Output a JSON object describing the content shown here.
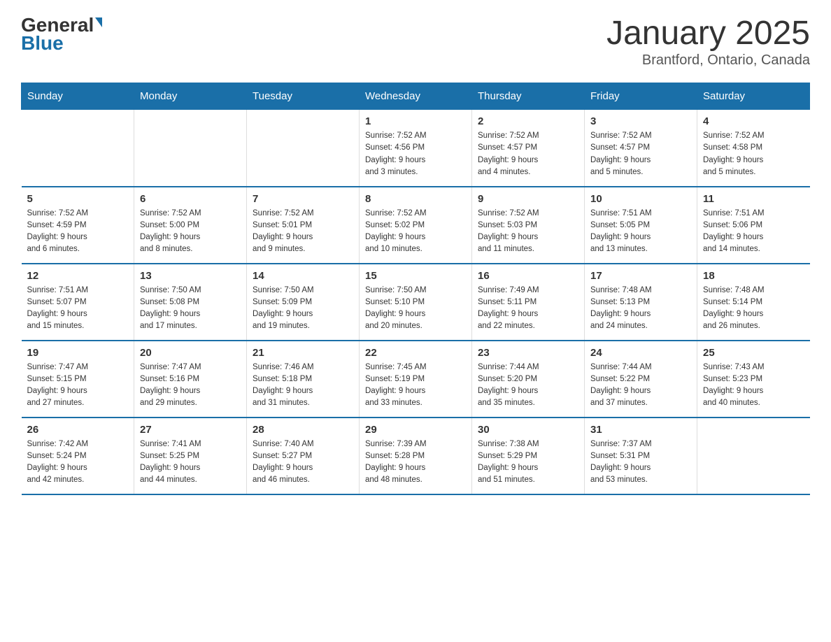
{
  "header": {
    "logo_general": "General",
    "logo_blue": "Blue",
    "month_title": "January 2025",
    "location": "Brantford, Ontario, Canada"
  },
  "days_of_week": [
    "Sunday",
    "Monday",
    "Tuesday",
    "Wednesday",
    "Thursday",
    "Friday",
    "Saturday"
  ],
  "weeks": [
    [
      {
        "day": "",
        "info": ""
      },
      {
        "day": "",
        "info": ""
      },
      {
        "day": "",
        "info": ""
      },
      {
        "day": "1",
        "info": "Sunrise: 7:52 AM\nSunset: 4:56 PM\nDaylight: 9 hours\nand 3 minutes."
      },
      {
        "day": "2",
        "info": "Sunrise: 7:52 AM\nSunset: 4:57 PM\nDaylight: 9 hours\nand 4 minutes."
      },
      {
        "day": "3",
        "info": "Sunrise: 7:52 AM\nSunset: 4:57 PM\nDaylight: 9 hours\nand 5 minutes."
      },
      {
        "day": "4",
        "info": "Sunrise: 7:52 AM\nSunset: 4:58 PM\nDaylight: 9 hours\nand 5 minutes."
      }
    ],
    [
      {
        "day": "5",
        "info": "Sunrise: 7:52 AM\nSunset: 4:59 PM\nDaylight: 9 hours\nand 6 minutes."
      },
      {
        "day": "6",
        "info": "Sunrise: 7:52 AM\nSunset: 5:00 PM\nDaylight: 9 hours\nand 8 minutes."
      },
      {
        "day": "7",
        "info": "Sunrise: 7:52 AM\nSunset: 5:01 PM\nDaylight: 9 hours\nand 9 minutes."
      },
      {
        "day": "8",
        "info": "Sunrise: 7:52 AM\nSunset: 5:02 PM\nDaylight: 9 hours\nand 10 minutes."
      },
      {
        "day": "9",
        "info": "Sunrise: 7:52 AM\nSunset: 5:03 PM\nDaylight: 9 hours\nand 11 minutes."
      },
      {
        "day": "10",
        "info": "Sunrise: 7:51 AM\nSunset: 5:05 PM\nDaylight: 9 hours\nand 13 minutes."
      },
      {
        "day": "11",
        "info": "Sunrise: 7:51 AM\nSunset: 5:06 PM\nDaylight: 9 hours\nand 14 minutes."
      }
    ],
    [
      {
        "day": "12",
        "info": "Sunrise: 7:51 AM\nSunset: 5:07 PM\nDaylight: 9 hours\nand 15 minutes."
      },
      {
        "day": "13",
        "info": "Sunrise: 7:50 AM\nSunset: 5:08 PM\nDaylight: 9 hours\nand 17 minutes."
      },
      {
        "day": "14",
        "info": "Sunrise: 7:50 AM\nSunset: 5:09 PM\nDaylight: 9 hours\nand 19 minutes."
      },
      {
        "day": "15",
        "info": "Sunrise: 7:50 AM\nSunset: 5:10 PM\nDaylight: 9 hours\nand 20 minutes."
      },
      {
        "day": "16",
        "info": "Sunrise: 7:49 AM\nSunset: 5:11 PM\nDaylight: 9 hours\nand 22 minutes."
      },
      {
        "day": "17",
        "info": "Sunrise: 7:48 AM\nSunset: 5:13 PM\nDaylight: 9 hours\nand 24 minutes."
      },
      {
        "day": "18",
        "info": "Sunrise: 7:48 AM\nSunset: 5:14 PM\nDaylight: 9 hours\nand 26 minutes."
      }
    ],
    [
      {
        "day": "19",
        "info": "Sunrise: 7:47 AM\nSunset: 5:15 PM\nDaylight: 9 hours\nand 27 minutes."
      },
      {
        "day": "20",
        "info": "Sunrise: 7:47 AM\nSunset: 5:16 PM\nDaylight: 9 hours\nand 29 minutes."
      },
      {
        "day": "21",
        "info": "Sunrise: 7:46 AM\nSunset: 5:18 PM\nDaylight: 9 hours\nand 31 minutes."
      },
      {
        "day": "22",
        "info": "Sunrise: 7:45 AM\nSunset: 5:19 PM\nDaylight: 9 hours\nand 33 minutes."
      },
      {
        "day": "23",
        "info": "Sunrise: 7:44 AM\nSunset: 5:20 PM\nDaylight: 9 hours\nand 35 minutes."
      },
      {
        "day": "24",
        "info": "Sunrise: 7:44 AM\nSunset: 5:22 PM\nDaylight: 9 hours\nand 37 minutes."
      },
      {
        "day": "25",
        "info": "Sunrise: 7:43 AM\nSunset: 5:23 PM\nDaylight: 9 hours\nand 40 minutes."
      }
    ],
    [
      {
        "day": "26",
        "info": "Sunrise: 7:42 AM\nSunset: 5:24 PM\nDaylight: 9 hours\nand 42 minutes."
      },
      {
        "day": "27",
        "info": "Sunrise: 7:41 AM\nSunset: 5:25 PM\nDaylight: 9 hours\nand 44 minutes."
      },
      {
        "day": "28",
        "info": "Sunrise: 7:40 AM\nSunset: 5:27 PM\nDaylight: 9 hours\nand 46 minutes."
      },
      {
        "day": "29",
        "info": "Sunrise: 7:39 AM\nSunset: 5:28 PM\nDaylight: 9 hours\nand 48 minutes."
      },
      {
        "day": "30",
        "info": "Sunrise: 7:38 AM\nSunset: 5:29 PM\nDaylight: 9 hours\nand 51 minutes."
      },
      {
        "day": "31",
        "info": "Sunrise: 7:37 AM\nSunset: 5:31 PM\nDaylight: 9 hours\nand 53 minutes."
      },
      {
        "day": "",
        "info": ""
      }
    ]
  ]
}
